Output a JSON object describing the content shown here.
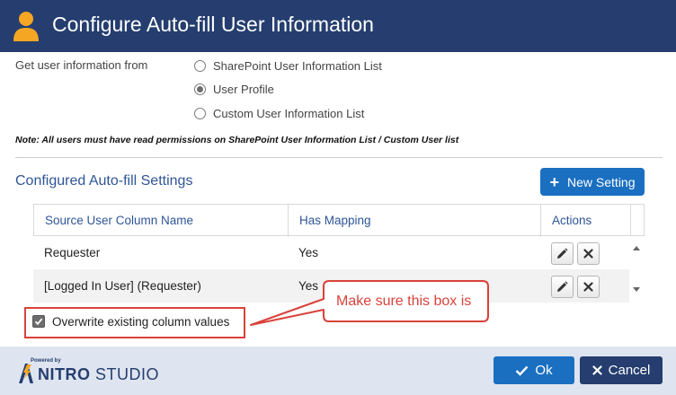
{
  "dialog": {
    "title": "Configure Auto-fill User Information",
    "title_icon": "user-icon"
  },
  "source": {
    "label": "Get user information from",
    "options": [
      {
        "label": "SharePoint User Information List",
        "selected": false
      },
      {
        "label": "User Profile",
        "selected": true
      },
      {
        "label": "Custom User Information List",
        "selected": false
      }
    ],
    "note": "Note: All users must have read permissions on SharePoint User Information List / Custom User list"
  },
  "settings": {
    "title": "Configured Auto-fill Settings",
    "new_button": "New Setting",
    "columns": [
      "Source User Column Name",
      "Has Mapping",
      "Actions"
    ],
    "rows": [
      {
        "source": "Requester",
        "mapping": "Yes"
      },
      {
        "source": "[Logged In User] (Requester)",
        "mapping": "Yes"
      }
    ]
  },
  "overwrite": {
    "label": "Overwrite existing column values",
    "checked": true
  },
  "callout": {
    "text": "Make sure this box is"
  },
  "footer": {
    "powered": "Powered by",
    "brand_bold": "NITRO",
    "brand_rest": " STUDIO",
    "ok": "Ok",
    "cancel": "Cancel"
  },
  "colors": {
    "title_bar": "#253e6f",
    "accent_blue": "#1a6fc1",
    "user_icon": "#f5a623",
    "callout_red": "#d9423b",
    "footer_bg": "#dfe5f0"
  }
}
